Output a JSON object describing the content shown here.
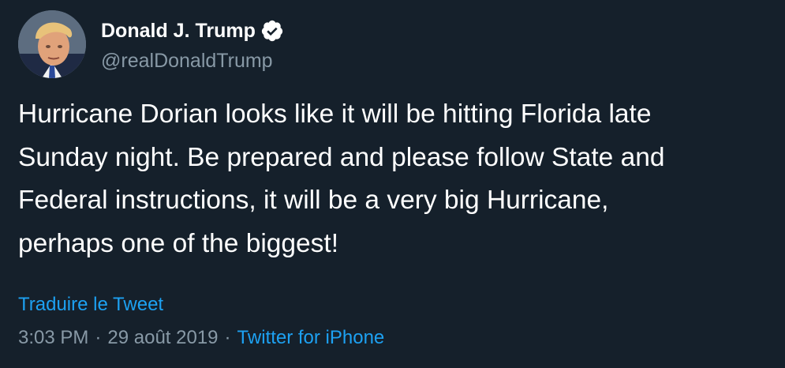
{
  "colors": {
    "background": "#15202b",
    "primary_text": "#ffffff",
    "secondary_text": "#8899a6",
    "link": "#1da1f2"
  },
  "author": {
    "name": "Donald J. Trump",
    "handle": "@realDonaldTrump",
    "verified_icon": "verified-badge-icon",
    "avatar_icon": "profile-avatar"
  },
  "tweet": {
    "lines": [
      "Hurricane Dorian looks like it will be hitting Florida late",
      "Sunday night. Be prepared and please follow State and",
      "Federal instructions, it will be a very big Hurricane,",
      "perhaps one of the biggest!"
    ],
    "translate_label": "Traduire le Tweet",
    "time": "3:03 PM",
    "date": "29 août 2019",
    "separator": "·",
    "source": "Twitter for iPhone"
  }
}
